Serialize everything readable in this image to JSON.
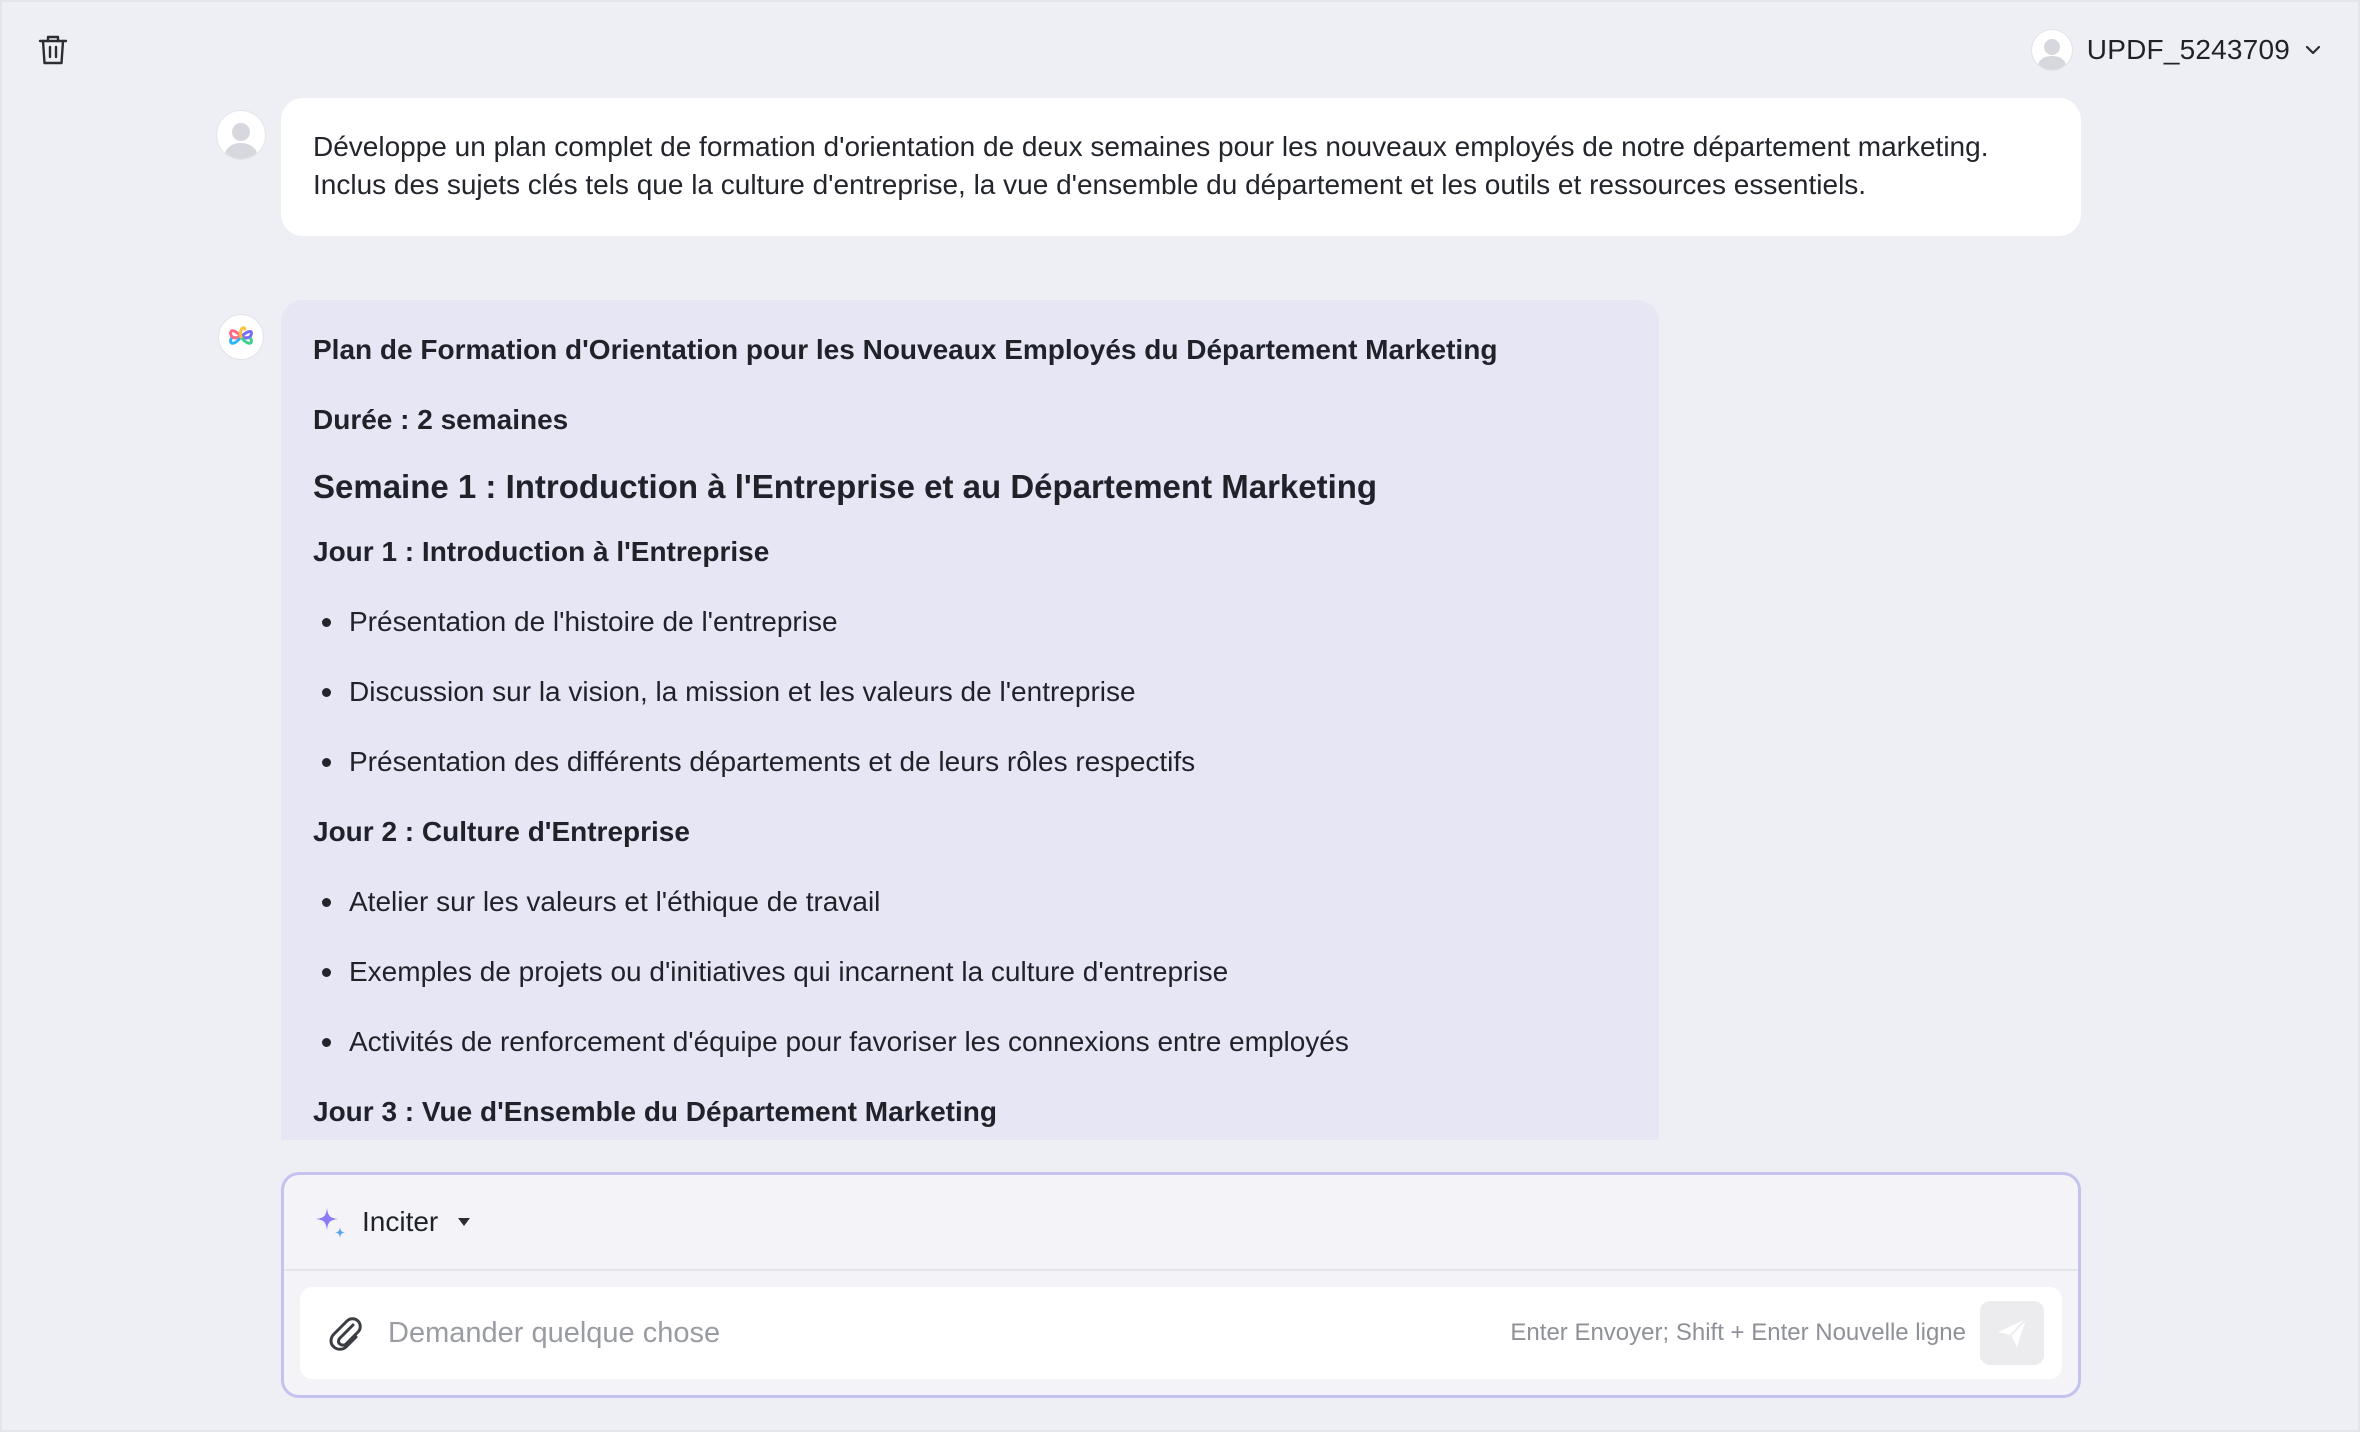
{
  "header": {
    "username": "UPDF_5243709"
  },
  "user_message": {
    "line1": "Développe un plan complet de formation d'orientation de deux semaines pour les nouveaux employés de notre département marketing.",
    "line2": "Inclus des sujets clés tels que la culture d'entreprise, la vue d'ensemble du département et les outils et ressources essentiels."
  },
  "ai_message": {
    "title": "Plan de Formation d'Orientation pour les Nouveaux Employés du Département Marketing",
    "duration": "Durée : 2 semaines",
    "week1": "Semaine 1 : Introduction à l'Entreprise et au Département Marketing",
    "day1": {
      "heading": "Jour 1 : Introduction à l'Entreprise",
      "items": [
        "Présentation de l'histoire de l'entreprise",
        "Discussion sur la vision, la mission et les valeurs de l'entreprise",
        "Présentation des différents départements et de leurs rôles respectifs"
      ]
    },
    "day2": {
      "heading": "Jour 2 : Culture d'Entreprise",
      "items": [
        "Atelier sur les valeurs et l'éthique de travail",
        "Exemples de projets ou d'initiatives qui incarnent la culture d'entreprise",
        "Activités de renforcement d'équipe pour favoriser les connexions entre employés"
      ]
    },
    "day3": {
      "heading": "Jour 3 : Vue d'Ensemble du Département Marketing"
    }
  },
  "composer": {
    "prompt_label": "Inciter",
    "placeholder": "Demander quelque chose",
    "hint": "Enter Envoyer; Shift + Enter Nouvelle ligne"
  },
  "colors": {
    "background": "#eeeff5",
    "ai_bubble": "#e7e6f4",
    "accent": "#8b7cf6",
    "composer_border": "#c4c2ef"
  },
  "icons": {
    "trash": "trash-icon",
    "avatar": "avatar-icon",
    "chevron": "chevron-down-icon",
    "ai": "ai-logo-icon",
    "sparkle": "sparkle-icon",
    "attach": "paperclip-icon",
    "send": "send-icon"
  }
}
